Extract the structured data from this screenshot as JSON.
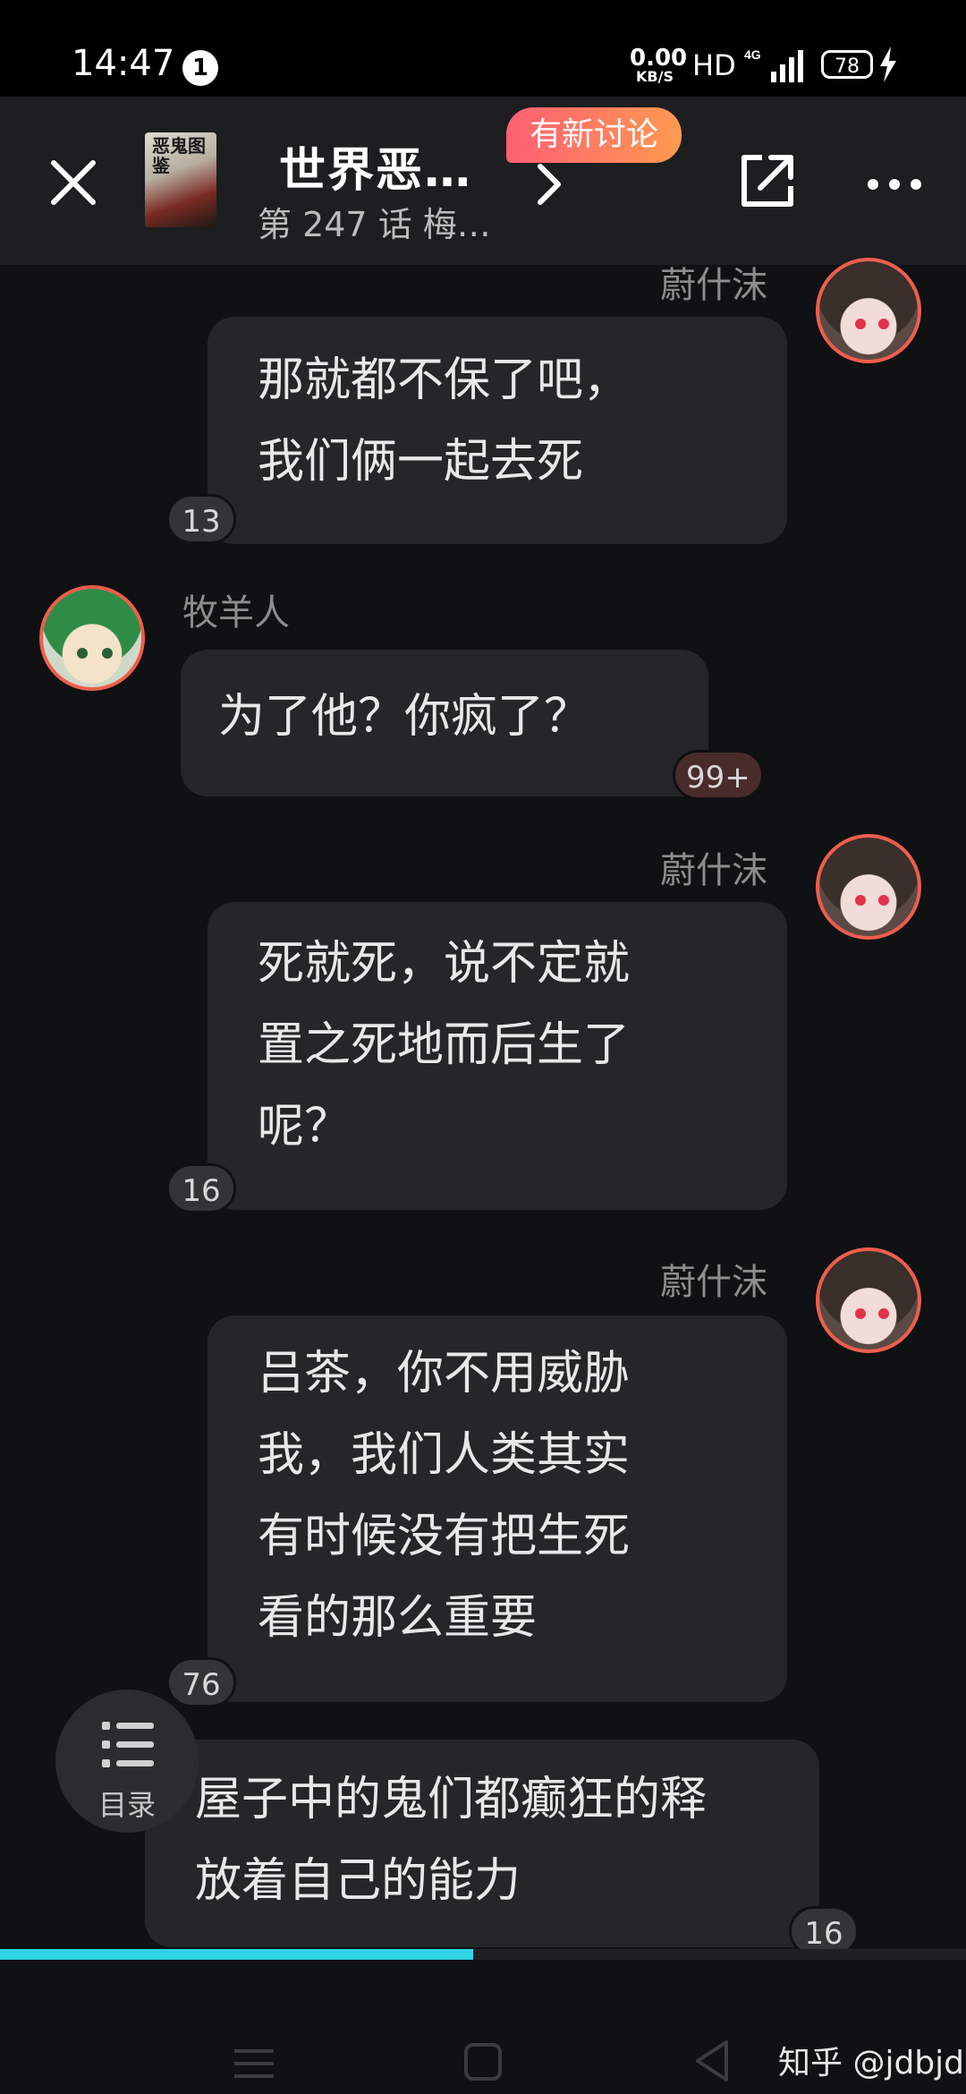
{
  "status_bar": {
    "time": "14:47",
    "notification_count": "1",
    "net_speed_value": "0.00",
    "net_speed_unit": "KB/S",
    "hd_label": "HD",
    "network_label": "4G",
    "battery_level": "78"
  },
  "header": {
    "cover_title": "恶鬼图鉴",
    "title": "世界恶…",
    "subtitle": "第 247 话 梅…",
    "new_discussion_badge": "有新讨论"
  },
  "messages": [
    {
      "speaker": "蔚什沫",
      "text": "那就都不保了吧，\n我们俩一起去死",
      "count": "13",
      "side": "right"
    },
    {
      "speaker": "牧羊人",
      "text": "为了他？你疯了？",
      "count": "99+",
      "side": "left"
    },
    {
      "speaker": "蔚什沫",
      "text": "死就死，说不定就\n置之死地而后生了\n呢？",
      "count": "16",
      "side": "right"
    },
    {
      "speaker": "蔚什沫",
      "text": "吕茶，你不用威胁\n我，我们人类其实\n有时候没有把生死\n看的那么重要",
      "count": "76",
      "side": "right"
    },
    {
      "speaker": "",
      "text": "屋子中的鬼们都癫狂的释\n放着自己的能力",
      "count": "16",
      "side": "narration"
    }
  ],
  "menu_button": {
    "label": "目录"
  },
  "reading_progress": 0.49,
  "watermark": "知乎 @jdbjd",
  "colors": {
    "accent": "#2fd3e4",
    "badge_start": "#ff5f73",
    "badge_end": "#ff9a4f",
    "avatar_ring": "#ee5e4d"
  }
}
